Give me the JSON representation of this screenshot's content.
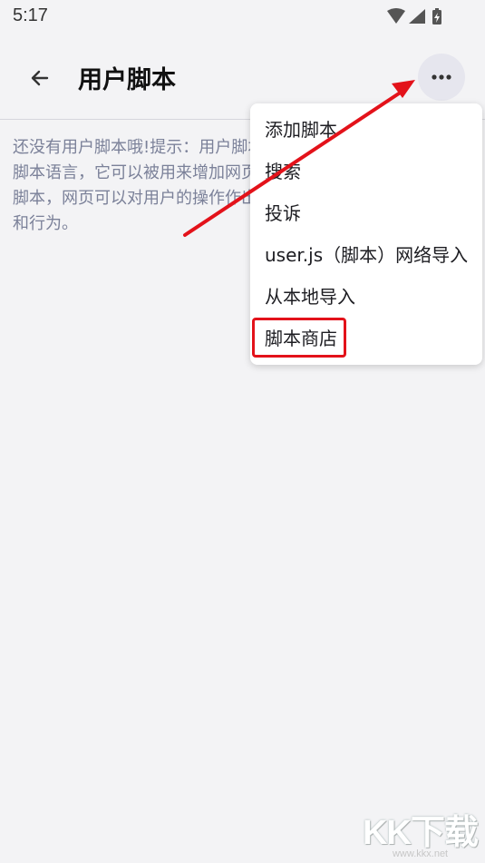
{
  "status_bar": {
    "time": "5:17",
    "icons": [
      "wifi-icon",
      "signal-icon",
      "battery-charging-icon"
    ]
  },
  "app_bar": {
    "title": "用户脚本",
    "back_icon": "arrow-left-icon",
    "more_icon": "more-horizontal-icon"
  },
  "main": {
    "empty_text": "还没有用户脚本哦!提示：用户脚本是一种用JavaScript编写的脚本语言，它可以被用来增加网页的功能。通过安装和使用用户脚本，网页可以对用户的操作作出反应，改变网页的内容、样式和行为。"
  },
  "menu": {
    "items": [
      {
        "label": "添加脚本"
      },
      {
        "label": "搜索"
      },
      {
        "label": "投诉"
      },
      {
        "label": "user.js（脚本）网络导入"
      },
      {
        "label": "从本地导入"
      },
      {
        "label": "脚本商店"
      }
    ],
    "highlight_color": "#e3121a"
  },
  "annotation": {
    "arrow_color": "#e3121a"
  },
  "watermark": {
    "logo": "KK下载",
    "url": "www.kkx.net"
  }
}
